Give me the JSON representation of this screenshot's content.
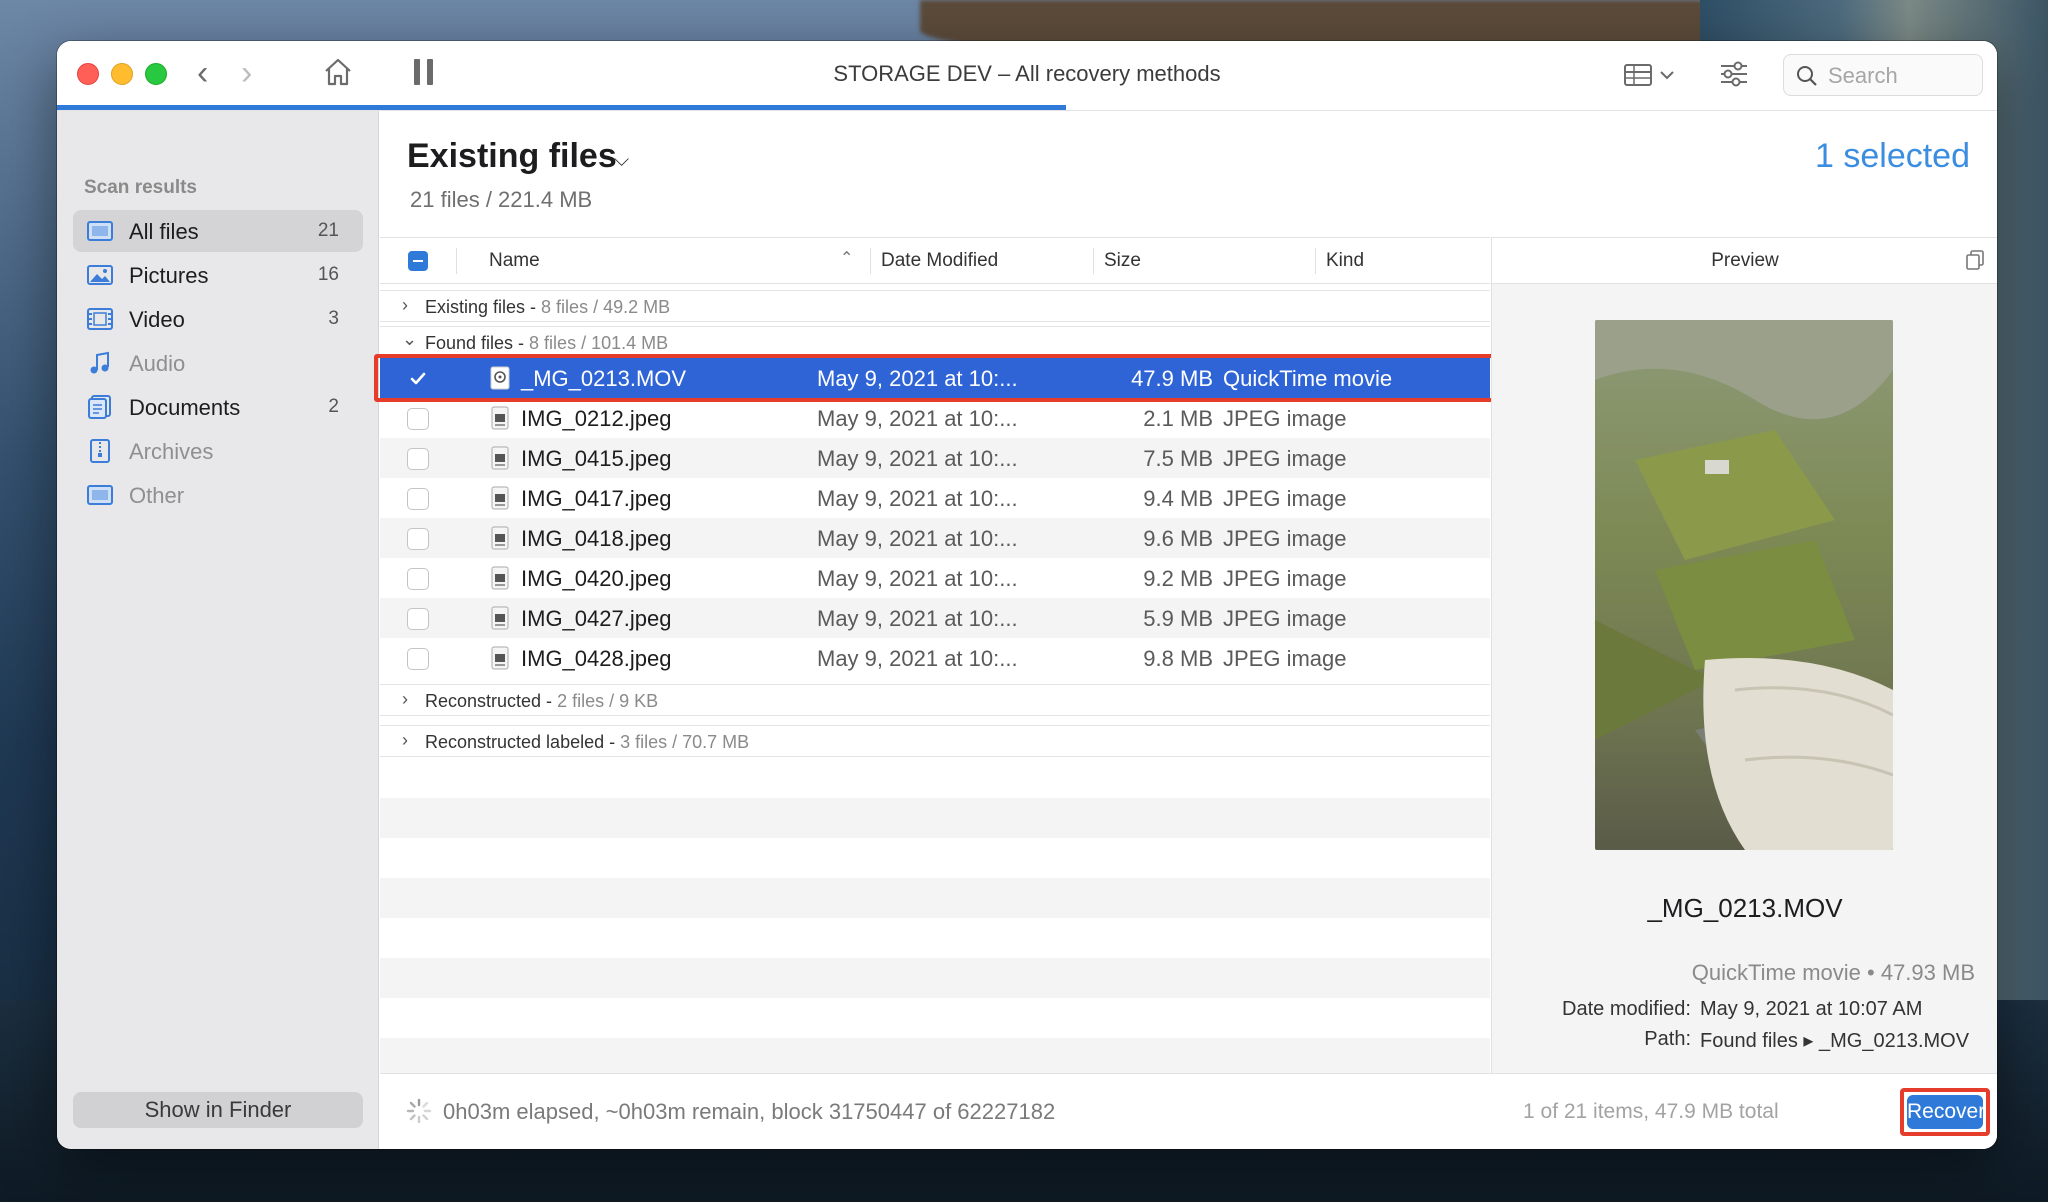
{
  "window": {
    "title": "STORAGE DEV – All recovery methods",
    "scan_progress": 0.52,
    "accent_color": "#2f7ad9",
    "search_placeholder": "Search"
  },
  "sidebar": {
    "heading": "Scan results",
    "items": [
      {
        "label": "All files",
        "count": "21",
        "icon": "files-icon"
      },
      {
        "label": "Pictures",
        "count": "16",
        "icon": "pictures-icon"
      },
      {
        "label": "Video",
        "count": "3",
        "icon": "video-icon"
      },
      {
        "label": "Audio",
        "count": "",
        "icon": "audio-icon"
      },
      {
        "label": "Documents",
        "count": "2",
        "icon": "documents-icon"
      },
      {
        "label": "Archives",
        "count": "",
        "icon": "archives-icon"
      },
      {
        "label": "Other",
        "count": "",
        "icon": "other-icon"
      }
    ],
    "show_in_finder": "Show in Finder"
  },
  "main": {
    "title": "Existing files",
    "subtitle": "21 files / 221.4 MB",
    "selected": "1 selected",
    "columns": {
      "name": "Name",
      "date": "Date Modified",
      "size": "Size",
      "kind": "Kind"
    },
    "groups": [
      {
        "name": "Existing files - ",
        "meta": "8 files / 49.2 MB"
      },
      {
        "name": "Found files - ",
        "meta": "8 files / 101.4 MB"
      },
      {
        "name": "Reconstructed - ",
        "meta": "2 files / 9 KB"
      },
      {
        "name": "Reconstructed labeled - ",
        "meta": "3 files / 70.7 MB"
      }
    ],
    "files": [
      {
        "name": "_MG_0213.MOV",
        "date": "May 9, 2021 at 10:...",
        "size": "47.9 MB",
        "kind": "QuickTime movie",
        "checked": true
      },
      {
        "name": "IMG_0212.jpeg",
        "date": "May 9, 2021 at 10:...",
        "size": "2.1 MB",
        "kind": "JPEG image",
        "checked": false
      },
      {
        "name": "IMG_0415.jpeg",
        "date": "May 9, 2021 at 10:...",
        "size": "7.5 MB",
        "kind": "JPEG image",
        "checked": false
      },
      {
        "name": "IMG_0417.jpeg",
        "date": "May 9, 2021 at 10:...",
        "size": "9.4 MB",
        "kind": "JPEG image",
        "checked": false
      },
      {
        "name": "IMG_0418.jpeg",
        "date": "May 9, 2021 at 10:...",
        "size": "9.6 MB",
        "kind": "JPEG image",
        "checked": false
      },
      {
        "name": "IMG_0420.jpeg",
        "date": "May 9, 2021 at 10:...",
        "size": "9.2 MB",
        "kind": "JPEG image",
        "checked": false
      },
      {
        "name": "IMG_0427.jpeg",
        "date": "May 9, 2021 at 10:...",
        "size": "5.9 MB",
        "kind": "JPEG image",
        "checked": false
      },
      {
        "name": "IMG_0428.jpeg",
        "date": "May 9, 2021 at 10:...",
        "size": "9.8 MB",
        "kind": "JPEG image",
        "checked": false
      }
    ]
  },
  "preview": {
    "title": "Preview",
    "file_name": "_MG_0213.MOV",
    "kind_size": "QuickTime movie • 47.93 MB",
    "date_label": "Date modified:",
    "date_value": "May 9, 2021 at 10:07 AM",
    "path_label": "Path:",
    "path_value": "Found files ▸ _MG_0213.MOV"
  },
  "footer": {
    "status": "0h03m elapsed, ~0h03m remain, block 31750447 of 62227182",
    "summary": "1 of 21 items, 47.9 MB total",
    "recover": "Recover"
  }
}
